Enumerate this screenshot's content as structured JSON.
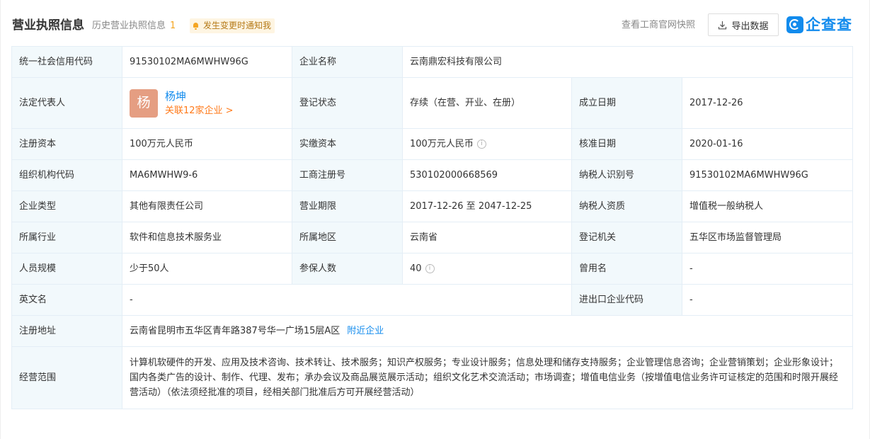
{
  "header": {
    "title": "营业执照信息",
    "history_label": "历史营业执照信息",
    "history_count": "1",
    "notify_label": "发生变更时通知我",
    "snapshot_link": "查看工商官网快照",
    "export_label": "导出数据",
    "logo_text": "企查查"
  },
  "info": {
    "credit_code_label": "统一社会信用代码",
    "credit_code": "91530102MA6MWHW96G",
    "company_name_label": "企业名称",
    "company_name": "云南鼎宏科技有限公司",
    "legal_rep_label": "法定代表人",
    "legal_rep_avatar": "杨",
    "legal_rep_name": "杨坤",
    "legal_rep_related": "关联12家企业 >",
    "status_label": "登记状态",
    "status": "存续（在营、开业、在册）",
    "founded_label": "成立日期",
    "founded": "2017-12-26",
    "reg_capital_label": "注册资本",
    "reg_capital": "100万元人民币",
    "paid_capital_label": "实缴资本",
    "paid_capital": "100万元人民币",
    "approved_label": "核准日期",
    "approved": "2020-01-16",
    "org_code_label": "组织机构代码",
    "org_code": "MA6MWHW9-6",
    "biz_reg_no_label": "工商注册号",
    "biz_reg_no": "530102000668569",
    "taxpayer_id_label": "纳税人识别号",
    "taxpayer_id": "91530102MA6MWHW96G",
    "company_type_label": "企业类型",
    "company_type": "其他有限责任公司",
    "term_label": "营业期限",
    "term": "2017-12-26 至 2047-12-25",
    "taxpayer_qual_label": "纳税人资质",
    "taxpayer_qual": "增值税一般纳税人",
    "industry_label": "所属行业",
    "industry": "软件和信息技术服务业",
    "region_label": "所属地区",
    "region": "云南省",
    "authority_label": "登记机关",
    "authority": "五华区市场监督管理局",
    "staff_size_label": "人员规模",
    "staff_size": "少于50人",
    "insured_label": "参保人数",
    "insured": "40",
    "former_name_label": "曾用名",
    "former_name": "-",
    "english_name_label": "英文名",
    "english_name": "-",
    "import_export_label": "进出口企业代码",
    "import_export": "-",
    "address_label": "注册地址",
    "address": "云南省昆明市五华区青年路387号华一广场15层A区",
    "nearby_link": "附近企业",
    "scope_label": "经营范围",
    "scope": "计算机软硬件的开发、应用及技术咨询、技术转让、技术服务；知识产权服务；专业设计服务；信息处理和储存支持服务；企业管理信息咨询；企业营销策划；企业形象设计；国内各类广告的设计、制作、代理、发布；承办会议及商品展览展示活动；组织文化艺术交流活动；市场调查；增值电信业务（按增值电信业务许可证核定的范围和时限开展经营活动）（依法须经批准的项目，经相关部门批准后方可开展经营活动）"
  },
  "colors": {
    "accent_blue": "#128BED",
    "orange": "#FF7A1A",
    "count_yellow": "#F5A623",
    "label_bg": "#F2F9FC",
    "avatar_bg": "#E59E82"
  },
  "icons": {
    "notify": "bell-icon",
    "export": "download-icon",
    "info": "info-icon",
    "logo": "qichacha-logo-icon"
  }
}
